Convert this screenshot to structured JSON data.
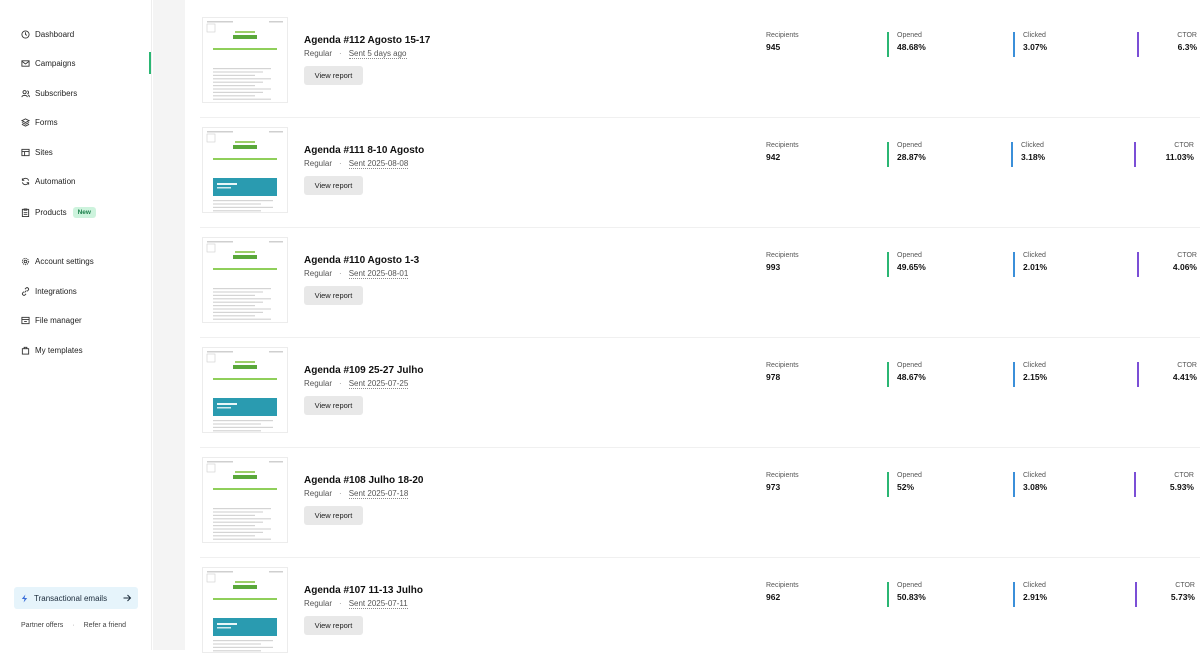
{
  "sidebar": {
    "items": [
      {
        "label": "Dashboard",
        "icon": "clock-icon"
      },
      {
        "label": "Campaigns",
        "icon": "mail-icon"
      },
      {
        "label": "Subscribers",
        "icon": "users-icon"
      },
      {
        "label": "Forms",
        "icon": "layers-icon"
      },
      {
        "label": "Sites",
        "icon": "layout-icon"
      },
      {
        "label": "Automation",
        "icon": "refresh-icon"
      },
      {
        "label": "Products",
        "icon": "clipboard-icon",
        "badge": "New"
      },
      {
        "label": "Account settings",
        "icon": "gear-icon"
      },
      {
        "label": "Integrations",
        "icon": "link-icon"
      },
      {
        "label": "File manager",
        "icon": "folder-icon"
      },
      {
        "label": "My templates",
        "icon": "template-icon"
      }
    ],
    "transactional": "Transactional emails",
    "partner_offers": "Partner offers",
    "refer_friend": "Refer a friend"
  },
  "labels": {
    "recipients": "Recipients",
    "opened": "Opened",
    "clicked": "Clicked",
    "ctor": "CTOR",
    "view_report": "View report"
  },
  "colors": {
    "accent": "#2bb673",
    "opened_bar": "#2bb673",
    "clicked_bar": "#3b8fd9",
    "ctor_bar": "#7b4fd6",
    "badge_bg": "#cdf3dd"
  },
  "campaigns": [
    {
      "title": "Agenda #112 Agosto 15-17",
      "type": "Regular",
      "sent": "Sent 5 days ago",
      "recipients": "945",
      "opened": "48.68%",
      "clicked": "3.07%",
      "ctor": "6.3%"
    },
    {
      "title": "Agenda #111 8-10 Agosto",
      "type": "Regular",
      "sent": "Sent 2025-08-08",
      "recipients": "942",
      "opened": "28.87%",
      "clicked": "3.18%",
      "ctor": "11.03%"
    },
    {
      "title": "Agenda #110 Agosto 1-3",
      "type": "Regular",
      "sent": "Sent 2025-08-01",
      "recipients": "993",
      "opened": "49.65%",
      "clicked": "2.01%",
      "ctor": "4.06%"
    },
    {
      "title": "Agenda #109 25-27 Julho",
      "type": "Regular",
      "sent": "Sent 2025-07-25",
      "recipients": "978",
      "opened": "48.67%",
      "clicked": "2.15%",
      "ctor": "4.41%"
    },
    {
      "title": "Agenda #108 Julho 18-20",
      "type": "Regular",
      "sent": "Sent 2025-07-18",
      "recipients": "973",
      "opened": "52%",
      "clicked": "3.08%",
      "ctor": "5.93%"
    },
    {
      "title": "Agenda #107 11-13 Julho",
      "type": "Regular",
      "sent": "Sent 2025-07-11",
      "recipients": "962",
      "opened": "50.83%",
      "clicked": "2.91%",
      "ctor": "5.73%"
    }
  ]
}
